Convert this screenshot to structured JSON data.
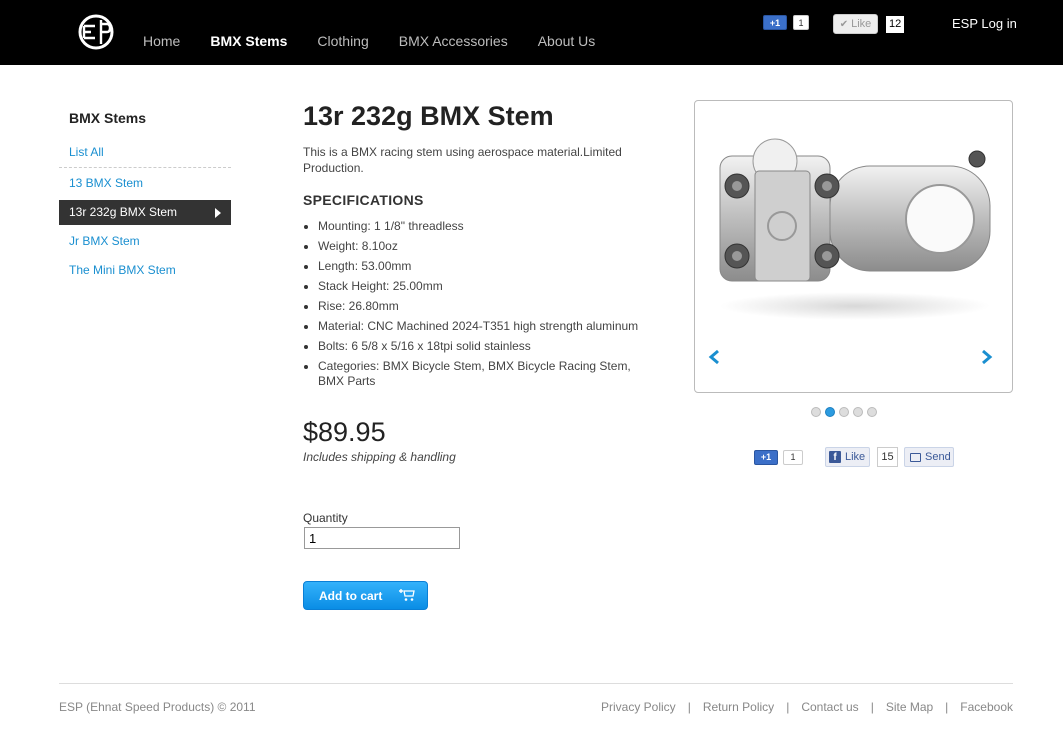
{
  "header": {
    "nav": [
      "Home",
      "BMX Stems",
      "Clothing",
      "BMX Accessories",
      "About Us"
    ],
    "active_nav": "BMX Stems",
    "gplus_label": "+1",
    "gplus_count": "1",
    "like_label": "Like",
    "like_count": "12",
    "login": "ESP Log in"
  },
  "sidebar": {
    "title": "BMX Stems",
    "items": [
      {
        "label": "List All"
      },
      {
        "label": "13 BMX Stem"
      },
      {
        "label": "13r 232g BMX Stem"
      },
      {
        "label": "Jr BMX Stem"
      },
      {
        "label": "The Mini BMX Stem"
      }
    ],
    "active": "13r 232g BMX Stem"
  },
  "product": {
    "title": "13r 232g BMX Stem",
    "description": "This is a BMX racing stem using aerospace material.Limited Production.",
    "specs_heading": "SPECIFICATIONS",
    "specs": [
      "Mounting: 1 1/8\" threadless",
      "Weight: 8.10oz",
      "Length: 53.00mm",
      "Stack Height: 25.00mm",
      "Rise: 26.80mm",
      "Material: CNC Machined 2024-T351 high strength aluminum",
      "Bolts: 6 5/8 x 5/16 x 18tpi solid stainless",
      "Categories: BMX Bicycle Stem, BMX Bicycle Racing Stem, BMX Parts"
    ],
    "price": "$89.95",
    "shipping_note": "Includes shipping & handling",
    "quantity_label": "Quantity",
    "quantity_value": "1",
    "add_to_cart": "Add to cart"
  },
  "gallery": {
    "slide_count": 5,
    "active_slide": 2
  },
  "social": {
    "gplus_label": "+1",
    "gplus_count": "1",
    "fb_like": "Like",
    "fb_count": "15",
    "fb_send": "Send"
  },
  "footer": {
    "copyright": "ESP (Ehnat Speed Products) © 2011",
    "links": [
      "Privacy Policy",
      "Return Policy",
      "Contact us",
      "Site Map",
      "Facebook"
    ]
  },
  "colors": {
    "header_bg": "#000000",
    "link_blue": "#1a8fd0",
    "button_blue": "#0a8de5"
  }
}
